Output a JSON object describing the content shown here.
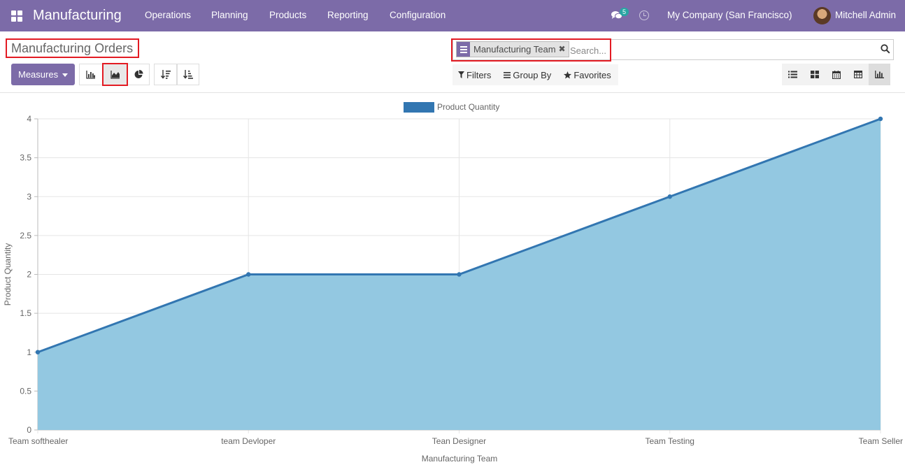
{
  "app": {
    "name": "Manufacturing"
  },
  "nav": {
    "menus": [
      "Operations",
      "Planning",
      "Products",
      "Reporting",
      "Configuration"
    ],
    "chat_count": "5",
    "company": "My Company (San Francisco)",
    "user": "Mitchell Admin"
  },
  "page": {
    "title": "Manufacturing Orders"
  },
  "search": {
    "facet_label": "Manufacturing Team",
    "placeholder": "Search..."
  },
  "toolbar": {
    "measures_label": "Measures",
    "filters_label": "Filters",
    "groupby_label": "Group By",
    "favorites_label": "Favorites"
  },
  "colors": {
    "brand": "#7c6ba8",
    "area_fill": "#93c8e1",
    "line": "#3276b1",
    "highlight": "#e31b23"
  },
  "chart_data": {
    "type": "area",
    "categories": [
      "Team softhealer",
      "team Devloper",
      "Tean Designer",
      "Team Testing",
      "Team Seller"
    ],
    "series": [
      {
        "name": "Product Quantity",
        "values": [
          1,
          2,
          2,
          3,
          4
        ]
      }
    ],
    "xlabel": "Manufacturing Team",
    "ylabel": "Product Quantity",
    "ylim": [
      0,
      4
    ],
    "yticks": [
      "0",
      "0.5",
      "1",
      "1.5",
      "2",
      "2.5",
      "3",
      "3.5",
      "4"
    ],
    "grid": true,
    "legend": "top-center"
  }
}
